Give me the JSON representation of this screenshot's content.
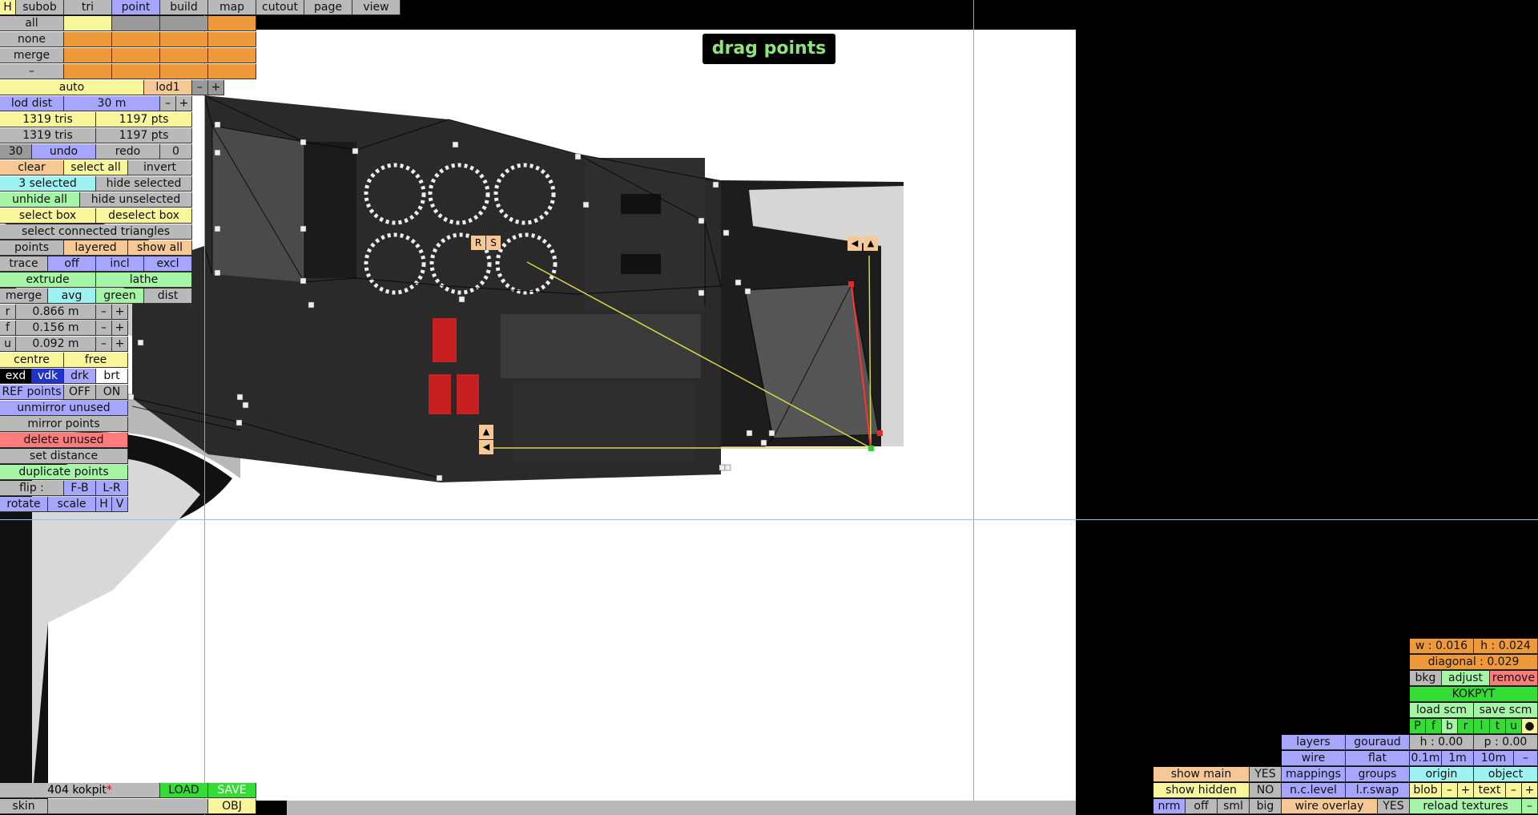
{
  "menu": {
    "h": "H",
    "tabs": [
      "subob",
      "tri",
      "point",
      "build",
      "map",
      "cutout",
      "page",
      "view"
    ],
    "active_tab": "point"
  },
  "select_rows": [
    "all",
    "none",
    "merge",
    "–"
  ],
  "hint": "drag points",
  "panel": {
    "auto": "auto",
    "lod1": "lod1",
    "minus": "–",
    "plus": "+",
    "lod_dist_label": "lod dist",
    "lod_dist_value": "30 m",
    "tris1": "1319 tris",
    "pts1": "1197 pts",
    "tris2": "1319 tris",
    "pts2": "1197 pts",
    "undo_count": "30",
    "undo": "undo",
    "redo": "redo",
    "redo_count": "0",
    "clear": "clear",
    "select_all": "select all",
    "invert": "invert",
    "selected": "3 selected",
    "hide_selected": "hide selected",
    "unhide_all": "unhide all",
    "hide_unselected": "hide unselected",
    "select_box": "select box",
    "deselect_box": "deselect box",
    "select_connected": "select connected triangles",
    "points": "points",
    "layered": "layered",
    "show_all": "show all",
    "trace": "trace",
    "off": "off",
    "incl": "incl",
    "excl": "excl",
    "extrude": "extrude",
    "lathe": "lathe",
    "merge": "merge",
    "avg": "avg",
    "green": "green",
    "dist": "dist",
    "r_label": "r",
    "r_value": "0.866 m",
    "f_label": "f",
    "f_value": "0.156 m",
    "u_label": "u",
    "u_value": "0.092 m",
    "centre": "centre",
    "free": "free",
    "exd": "exd",
    "vdk": "vdk",
    "drk": "drk",
    "brt": "brt",
    "ref_points": "REF points",
    "ref_off": "OFF",
    "ref_on": "ON",
    "unmirror": "unmirror unused",
    "mirror": "mirror points",
    "delete_unused": "delete unused",
    "set_distance": "set distance",
    "duplicate": "duplicate points",
    "flip": "flip :",
    "fb": "F-B",
    "lr": "L-R",
    "rotate": "rotate",
    "scale": "scale",
    "h": "H",
    "v": "V"
  },
  "handles": {
    "r": "R",
    "s": "S",
    "left": "◀",
    "up": "▲"
  },
  "file": {
    "name": "404 kokpit",
    "modified_mark": "*",
    "load": "LOAD",
    "save": "SAVE",
    "skin": "skin",
    "obj": "OBJ"
  },
  "right_panel": {
    "w": "w : 0.016",
    "h": "h : 0.024",
    "diagonal": "diagonal : 0.029",
    "bkg": "bkg",
    "adjust": "adjust",
    "remove": "remove",
    "name": "KOKPYT",
    "load_scm": "load scm",
    "save_scm": "save scm",
    "letters": [
      "P",
      "f",
      "b",
      "r",
      "l",
      "t",
      "u",
      "●"
    ],
    "layers": "layers",
    "gouraud": "gouraud",
    "h00": "h : 0.00",
    "p00": "p : 0.00",
    "wire": "wire",
    "flat": "flat",
    "s01": "0.1m",
    "s1": "1m",
    "s10": "10m",
    "dash": "–",
    "show_main": "show main",
    "yes": "YES",
    "mappings": "mappings",
    "groups": "groups",
    "origin": "origin",
    "object": "object",
    "show_hidden": "show hidden",
    "no": "NO",
    "nclevel": "n.c.level",
    "lrswap": "l.r.swap",
    "blob": "blob",
    "minus": "–",
    "plus": "+",
    "text": "text",
    "nrm": "nrm",
    "off": "off",
    "sml": "sml",
    "big": "big",
    "wire_overlay": "wire overlay",
    "reload": "reload textures"
  },
  "colors": {
    "canvas": "#ffffff",
    "selected_point": "#ff2222",
    "active_point": "#33cc33",
    "guide_line": "#d8d84a"
  }
}
